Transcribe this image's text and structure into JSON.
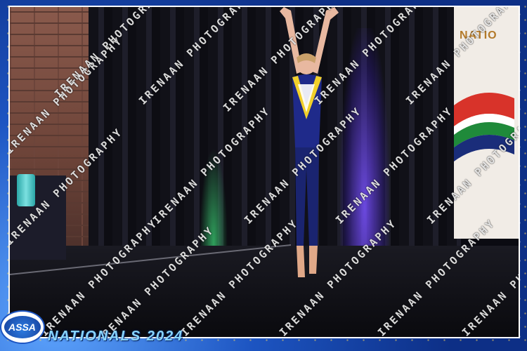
{
  "photo": {
    "banner_text": "NATIO",
    "watermark_text": "IRENAAN PHOTOGRAPHY"
  },
  "branding": {
    "logo_text": "ASSA",
    "event_title": "NATIONALS 2024"
  },
  "colors": {
    "frame_blue": "#1b4fb0",
    "title_cyan": "#8ad6ff",
    "accent_gold": "#ffd75a"
  }
}
